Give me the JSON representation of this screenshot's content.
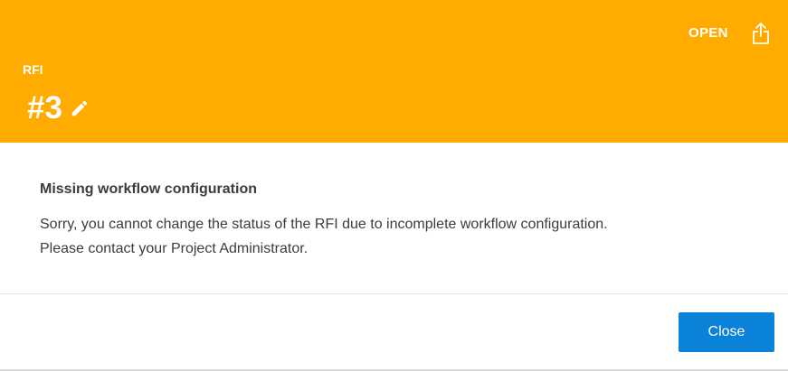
{
  "colors": {
    "header_bg": "#ffab00",
    "primary_button": "#0a82d7",
    "text": "#3c3c3c"
  },
  "header": {
    "type_label": "RFI",
    "number": "#3",
    "status": "OPEN",
    "share_icon": "share-upload-icon",
    "edit_icon": "pencil-icon"
  },
  "body": {
    "title": "Missing workflow configuration",
    "message": "Sorry, you cannot change the status of the RFI due to incomplete workflow configuration.\nPlease contact your Project Administrator."
  },
  "footer": {
    "close_label": "Close"
  }
}
